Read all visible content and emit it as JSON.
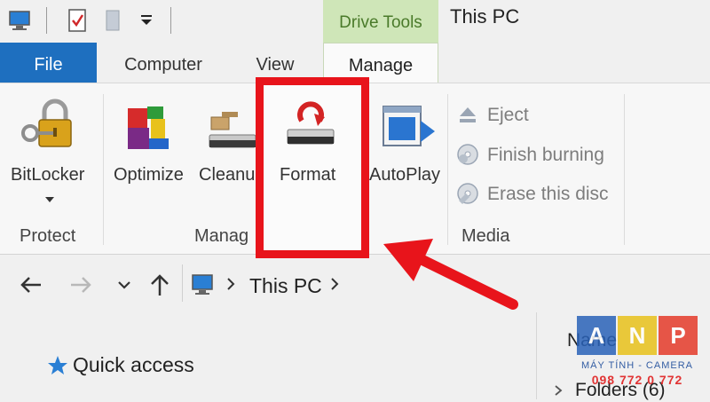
{
  "titlebar": {
    "context_tab": "Drive Tools",
    "window_title": "This PC"
  },
  "tabs": [
    {
      "label": "File"
    },
    {
      "label": "Computer"
    },
    {
      "label": "View"
    },
    {
      "label": "Manage"
    }
  ],
  "ribbon": {
    "bitlocker_label": "BitLocker",
    "optimize_label": "Optimize",
    "cleanup_label": "Cleanu",
    "format_label": "Format",
    "autoplay_label": "AutoPlay",
    "eject_label": "Eject",
    "finish_burning_label": "Finish burning",
    "erase_disc_label": "Erase this disc",
    "group_protect": "Protect",
    "group_manage": "Manag",
    "group_media": "Media"
  },
  "navigation": {
    "address_text": "This PC"
  },
  "content": {
    "quick_access_label": "Quick access",
    "name_column": "Name",
    "folders_label": "Folders (6)"
  },
  "watermark": {
    "letters": [
      "A",
      "N",
      "P"
    ],
    "line1": "MÁY TÍNH - CAMERA",
    "line2": "098 772 0 772"
  },
  "colors": {
    "accent_file_tab": "#1e6fbf",
    "drive_tools": "#cfe6b8",
    "highlight": "#e8141b",
    "arrow": "#e8141b"
  }
}
